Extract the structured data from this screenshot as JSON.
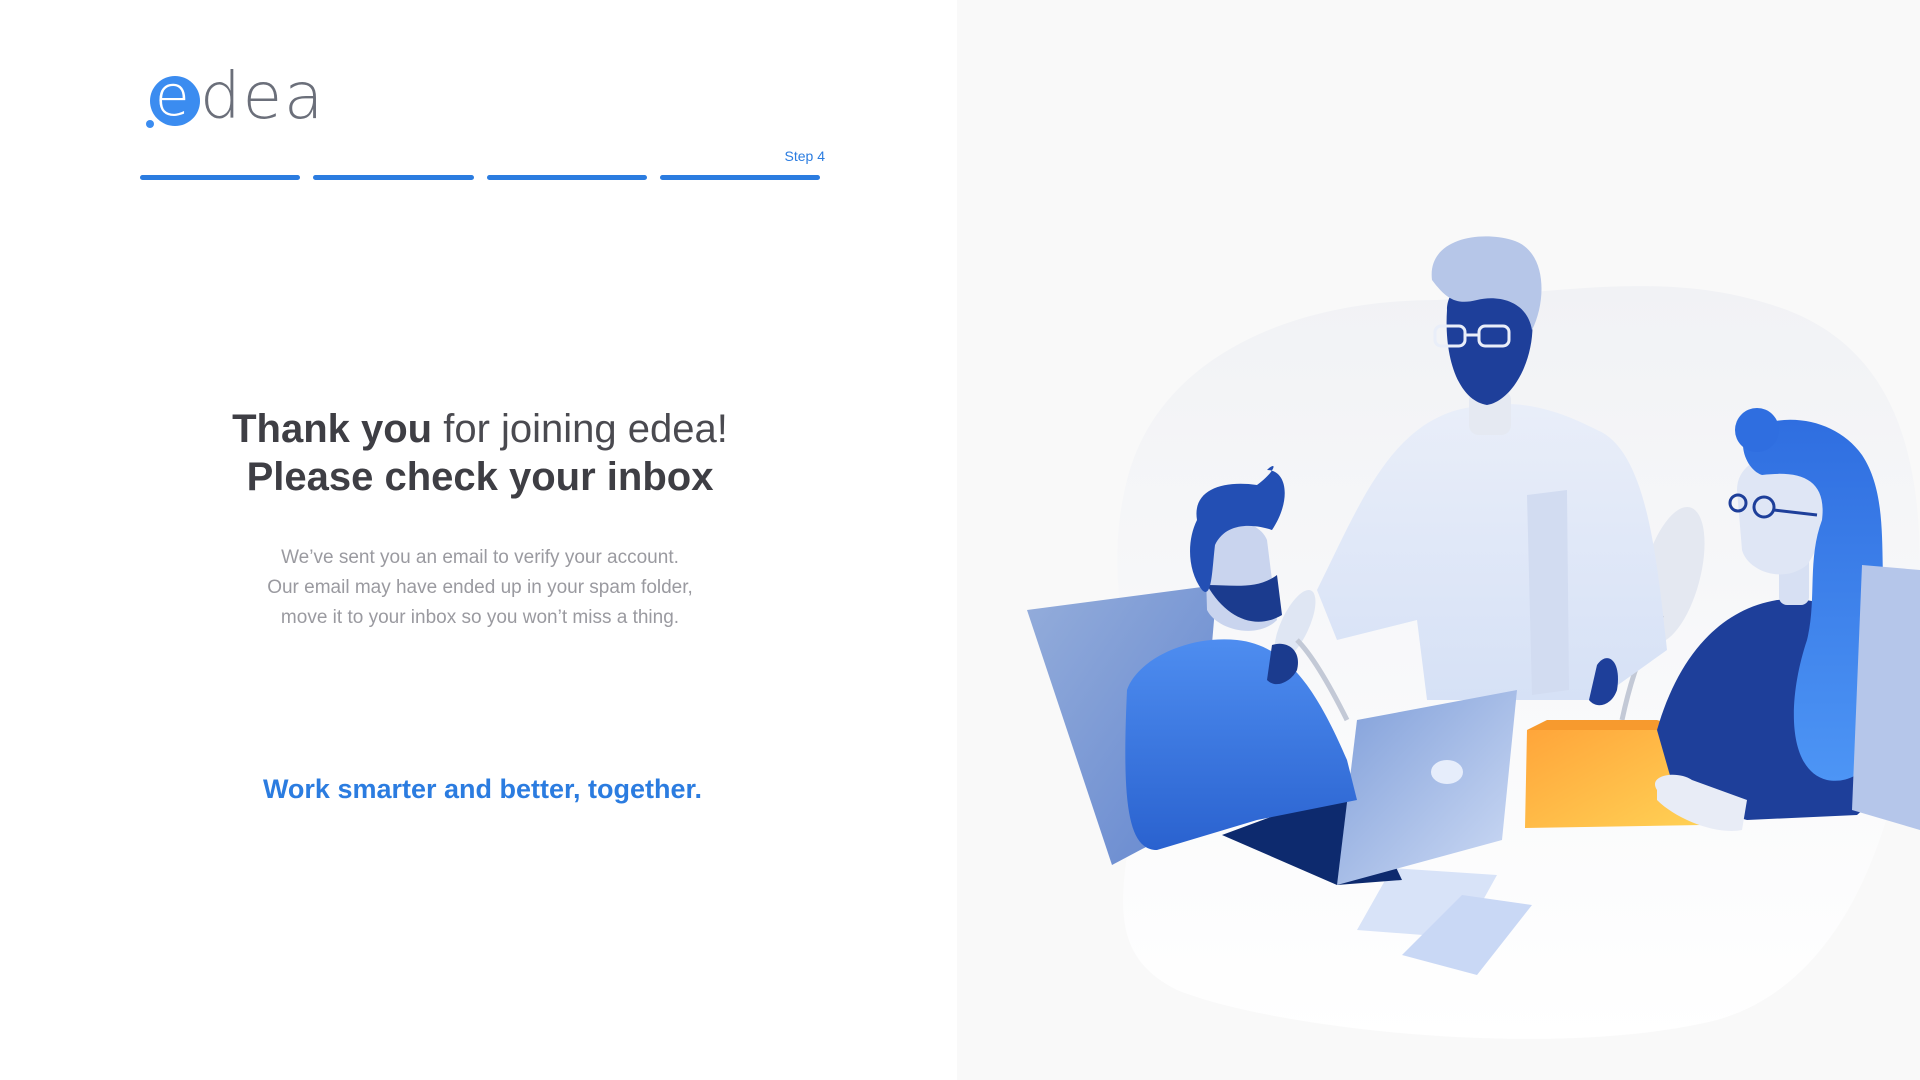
{
  "logo": {
    "initial": "e",
    "rest": "dea"
  },
  "progress": {
    "step_label": "Step 4",
    "segments": 4,
    "completed": 4
  },
  "headline": {
    "line1_bold": "Thank you",
    "line1_light": " for joining edea!",
    "line2": "Please check your inbox"
  },
  "message": {
    "line1": "We’ve sent you an email to verify your account.",
    "line2": "Our email may have ended up in your spam folder,",
    "line3": "move it to your inbox so you won’t miss a thing."
  },
  "tagline": "Work smarter and better, together.",
  "colors": {
    "accent": "#2b7ce0",
    "heading": "#3e3e44",
    "muted": "#9a9aa0",
    "panel_bg": "#f9f9f9"
  }
}
